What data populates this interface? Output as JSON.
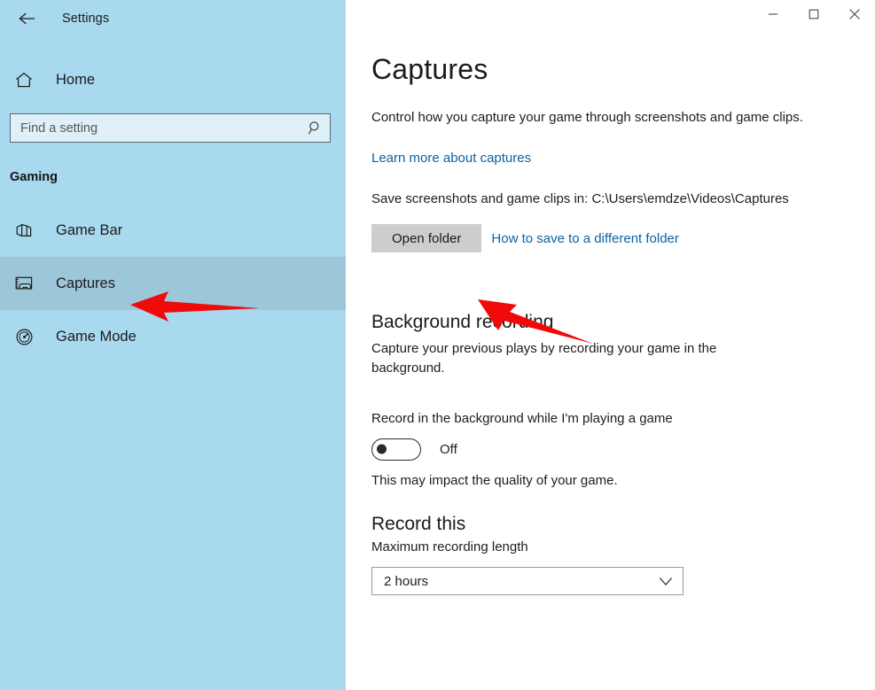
{
  "window": {
    "app_title": "Settings",
    "controls": {
      "minimize": "minimize-button",
      "maximize": "maximize-button",
      "close": "close-button"
    }
  },
  "sidebar": {
    "back_icon": "back-arrow-icon",
    "home": {
      "label": "Home",
      "icon": "home-icon"
    },
    "search": {
      "placeholder": "Find a setting",
      "value": "",
      "icon": "search-icon"
    },
    "section_header": "Gaming",
    "items": [
      {
        "label": "Game Bar",
        "icon": "game-bar-icon",
        "selected": false
      },
      {
        "label": "Captures",
        "icon": "captures-icon",
        "selected": true
      },
      {
        "label": "Game Mode",
        "icon": "game-mode-icon",
        "selected": false
      }
    ]
  },
  "main": {
    "page_title": "Captures",
    "intro": "Control how you capture your game through screenshots and game clips.",
    "learn_more_link": "Learn more about captures",
    "save_path_text": "Save screenshots and game clips in: C:\\Users\\emdze\\Videos\\Captures",
    "open_folder_button": "Open folder",
    "different_folder_link": "How to save to a different folder",
    "background_recording": {
      "title": "Background recording",
      "description": "Capture your previous plays by recording your game in the background.",
      "toggle_label": "Record in the background while I'm playing a game",
      "toggle_state": "Off",
      "note": "This may impact the quality of your game."
    },
    "record_this": {
      "title": "Record this",
      "field_label": "Maximum recording length",
      "dropdown_value": "2 hours",
      "dropdown_icon": "chevron-down-icon"
    }
  },
  "annotations": {
    "arrow_color": "#f10a0a",
    "arrows": [
      {
        "name": "arrow-pointing-captures",
        "direction": "left"
      },
      {
        "name": "arrow-pointing-open-folder",
        "direction": "up-left"
      }
    ]
  }
}
